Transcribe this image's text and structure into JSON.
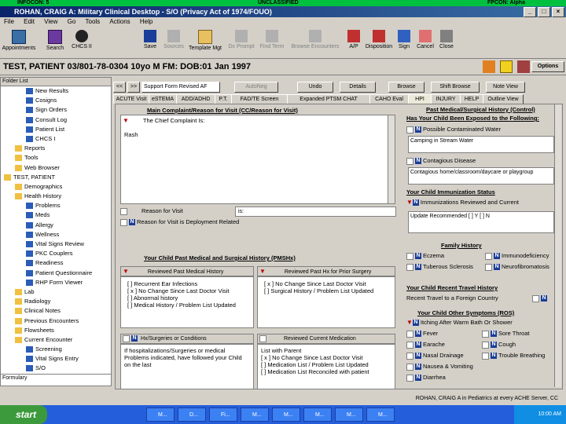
{
  "classification": {
    "left": "INFOCON: 5",
    "center": "UNCLASSIFIED",
    "right": "FPCON: Alpha"
  },
  "window": {
    "title": "ROHAN, CRAIG A: Military Clinical Desktop - S/O (Privacy Act of 1974/FOUO)"
  },
  "menu": [
    "File",
    "Edit",
    "View",
    "Go",
    "Tools",
    "Actions",
    "Help"
  ],
  "toolbar_left": [
    {
      "label": "Appointments",
      "icon": "appointments-icon"
    },
    {
      "label": "Search",
      "icon": "search-icon"
    },
    {
      "label": "CHCS II",
      "icon": "chcs-icon"
    }
  ],
  "toolbar_right": [
    {
      "label": "Save",
      "icon": "save-icon"
    },
    {
      "label": "Sources",
      "icon": "sources-icon"
    },
    {
      "label": "Template Mgt",
      "icon": "template-icon"
    },
    {
      "label": "Dx Prompt",
      "icon": "dx-icon"
    },
    {
      "label": "Find Term",
      "icon": "find-icon"
    },
    {
      "label": "Browse Encounters",
      "icon": "browse-icon"
    },
    {
      "label": "A/P",
      "icon": "ap-icon"
    },
    {
      "label": "Disposition",
      "icon": "disposition-icon"
    },
    {
      "label": "Sign",
      "icon": "sign-icon"
    },
    {
      "label": "Cancel",
      "icon": "cancel-icon"
    },
    {
      "label": "Close",
      "icon": "close-icon"
    }
  ],
  "patient": {
    "banner": "TEST, PATIENT  03/801-78-0304  10yo  M  FM:  DOB:01 Jan 1997",
    "options_label": "Options"
  },
  "folder_list": {
    "header": "Folder List",
    "items": [
      {
        "label": "New Results",
        "indent": 2
      },
      {
        "label": "Cosigns",
        "indent": 2
      },
      {
        "label": "Sign Orders",
        "indent": 2
      },
      {
        "label": "Consult Log",
        "indent": 2
      },
      {
        "label": "Patient List",
        "indent": 2
      },
      {
        "label": "CHCS I",
        "indent": 2
      },
      {
        "label": "Reports",
        "indent": 1
      },
      {
        "label": "Tools",
        "indent": 1
      },
      {
        "label": "Web Browser",
        "indent": 1
      },
      {
        "label": "TEST, PATIENT",
        "indent": 0
      },
      {
        "label": "Demographics",
        "indent": 1
      },
      {
        "label": "Health History",
        "indent": 1
      },
      {
        "label": "Problems",
        "indent": 2
      },
      {
        "label": "Meds",
        "indent": 2
      },
      {
        "label": "Allergy",
        "indent": 2
      },
      {
        "label": "Wellness",
        "indent": 2
      },
      {
        "label": "Vital Signs Review",
        "indent": 2
      },
      {
        "label": "PKC Couplers",
        "indent": 2
      },
      {
        "label": "Readiness",
        "indent": 2
      },
      {
        "label": "Patient Questionnaire",
        "indent": 2
      },
      {
        "label": "RHP Form Viewer",
        "indent": 2
      },
      {
        "label": "Lab",
        "indent": 1
      },
      {
        "label": "Radiology",
        "indent": 1
      },
      {
        "label": "Clinical Notes",
        "indent": 1
      },
      {
        "label": "Previous Encounters",
        "indent": 1
      },
      {
        "label": "Flowsheets",
        "indent": 1
      },
      {
        "label": "Current Encounter",
        "indent": 1
      },
      {
        "label": "Screening",
        "indent": 2
      },
      {
        "label": "Vital Signs Entry",
        "indent": 2
      },
      {
        "label": "S/O",
        "indent": 2
      },
      {
        "label": "A/P",
        "indent": 2
      }
    ],
    "formulary": "Formulary"
  },
  "nav": {
    "back": "<<",
    "forward": ">>",
    "template": "Support Form Revised AF",
    "autoneg": "AutoNeg",
    "undo": "Undo",
    "details": "Details",
    "browse": "Browse",
    "shift_browse": "Shift Browse",
    "note_view": "Note View"
  },
  "tabs": [
    "ACUTE Visit",
    "eSTEMA",
    "ADD/ADHD",
    "P.T.",
    "FAD/TE Screen",
    "Expanded PTSM CHAT",
    "CAHO Eval",
    "HPI",
    "INJURY",
    "HELP",
    "Outline View"
  ],
  "left_sections": {
    "chief_complaint_title": "Main Complaint/Reason for Visit (CC/Reason for Visit)",
    "chief_complaint_label": "The Chief Complaint Is:",
    "chief_complaint_value": "Rash",
    "reason_for_visit": "Reason for Visit",
    "reason_value": "is:",
    "deployment": "Reason for Visit is Deployment Related",
    "pmsh_title": "Your Child Past Medical and Surgical History (PMSHx)",
    "reviewed_pmh": "Reviewed Past Medical History",
    "pmh_lines": [
      "[ ] Recurrent Ear Infections",
      "[ x ] No Change Since Last Doctor Visit",
      "[ ] Abnormal history",
      "[ ] Medical History / Problem List Updated"
    ],
    "reviewed_surgery": "Reviewed Past Hx for Prior Surgery",
    "surgery_lines": [
      "[ x ] No Change Since Last Doctor Visit",
      "[ ] Surgical History / Problem List Updated"
    ],
    "hospitalizations": "Hx/Surgeries or Conditions",
    "hosp_text": "If hospitalizations/Surgeries or medical Problems indicated, have followed your Child on the last",
    "reviewed_meds": "Reviewed Current Medication",
    "meds_lines": [
      "List with Parent",
      "[ x ] No Change Since Last Doctor Visit",
      "[ ] Medication List / Problem List Updated",
      "[ ] Medication List Reconciled with patient"
    ]
  },
  "right_sections": {
    "pmsh_control": "Past Medical/Surgical History (Control)",
    "exposed_title": "Has Your Child Been Exposed to the Following:",
    "contaminated_water": "Possible Contaminated Water",
    "water_value": "Camping in Stream Water",
    "contagious_disease": "Contagious Disease",
    "disease_value": "Contagious home/classroom/daycare or playgroup",
    "immunization_title": "Your Child Immunization Status",
    "immunizations_reviewed": "Immunizations Reviewed and Current",
    "immunization_value": "Update Recommended [ ] Y [ ] N",
    "family_title": "Family History",
    "family_items": [
      "Eczema",
      "Immunodeficiency",
      "Tuberous Sclerosis",
      "Neurofibromatosis"
    ],
    "travel_title": "Your Child Recent Travel History",
    "travel_label": "Recent Travel to a Foreign Country",
    "other_title": "Your Child Other Symptoms (ROS)",
    "itching": "Itching After Warm Bath Or Shower",
    "symptoms_left": [
      "Fever",
      "Earache",
      "Nasal Drainage",
      "Nausea & Vomiting",
      "Diarrhea"
    ],
    "symptoms_right": [
      "Sore Throat",
      "Cough",
      "Trouble Breathing"
    ]
  },
  "status": {
    "text": "ROHAN, CRAIG A in Pediatrics at every ACHE Server, CC"
  },
  "taskbar": {
    "start": "start",
    "items": [
      "M...",
      "D...",
      "Fi...",
      "M...",
      "M...",
      "M...",
      "M...",
      "M..."
    ],
    "clock": "10:00 AM"
  },
  "colors": {
    "title": "#0a246a",
    "classification": "#00c040",
    "taskbar": "#245edb"
  }
}
